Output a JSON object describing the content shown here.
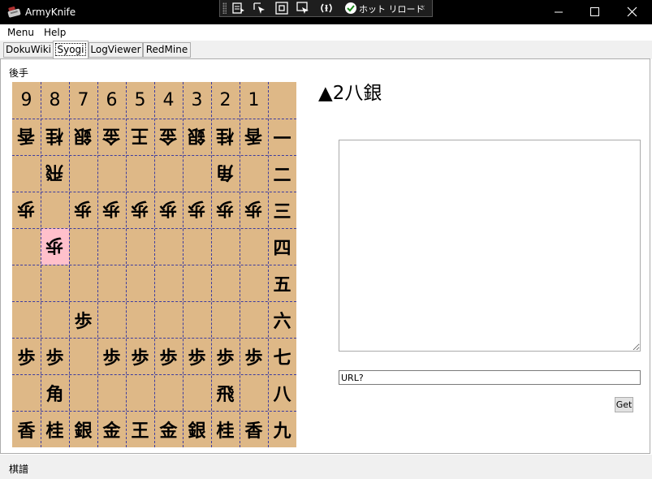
{
  "titlebar": {
    "title": "ArmyKnife",
    "hot_reload_label": "ホット リロード",
    "collapse_glyph": "‹",
    "minimize_glyph": "—",
    "maximize_glyph": "☐",
    "close_glyph": "✕"
  },
  "menu": {
    "items": [
      "Menu",
      "Help"
    ]
  },
  "tabs": [
    {
      "label": "DokuWiki",
      "active": false
    },
    {
      "label": "Syogi",
      "active": true
    },
    {
      "label": "LogViewer",
      "active": false
    },
    {
      "label": "RedMine",
      "active": false
    }
  ],
  "syogi": {
    "gote_label": "後手",
    "file_labels": [
      "9",
      "8",
      "7",
      "6",
      "5",
      "4",
      "3",
      "2",
      "1"
    ],
    "rank_labels": [
      "一",
      "二",
      "三",
      "四",
      "五",
      "六",
      "七",
      "八",
      "九"
    ],
    "rows": [
      [
        [
          "香",
          "g"
        ],
        [
          "桂",
          "g"
        ],
        [
          "銀",
          "g"
        ],
        [
          "金",
          "g"
        ],
        [
          "王",
          "g"
        ],
        [
          "金",
          "g"
        ],
        [
          "銀",
          "g"
        ],
        [
          "桂",
          "g"
        ],
        [
          "香",
          "g"
        ]
      ],
      [
        null,
        [
          "飛",
          "g"
        ],
        null,
        null,
        null,
        null,
        null,
        [
          "角",
          "g"
        ],
        null
      ],
      [
        [
          "歩",
          "g"
        ],
        null,
        [
          "歩",
          "g"
        ],
        [
          "歩",
          "g"
        ],
        [
          "歩",
          "g"
        ],
        [
          "歩",
          "g"
        ],
        [
          "歩",
          "g"
        ],
        [
          "歩",
          "g"
        ],
        [
          "歩",
          "g"
        ]
      ],
      [
        null,
        [
          "歩",
          "g"
        ],
        null,
        null,
        null,
        null,
        null,
        null,
        null
      ],
      [
        null,
        null,
        null,
        null,
        null,
        null,
        null,
        null,
        null
      ],
      [
        null,
        null,
        [
          "歩",
          "s"
        ],
        null,
        null,
        null,
        null,
        null,
        null
      ],
      [
        [
          "歩",
          "s"
        ],
        [
          "歩",
          "s"
        ],
        null,
        [
          "歩",
          "s"
        ],
        [
          "歩",
          "s"
        ],
        [
          "歩",
          "s"
        ],
        [
          "歩",
          "s"
        ],
        [
          "歩",
          "s"
        ],
        [
          "歩",
          "s"
        ]
      ],
      [
        null,
        [
          "角",
          "s"
        ],
        null,
        null,
        null,
        null,
        null,
        [
          "飛",
          "s"
        ],
        null
      ],
      [
        [
          "香",
          "s"
        ],
        [
          "桂",
          "s"
        ],
        [
          "銀",
          "s"
        ],
        [
          "金",
          "s"
        ],
        [
          "王",
          "s"
        ],
        [
          "金",
          "s"
        ],
        [
          "銀",
          "s"
        ],
        [
          "桂",
          "s"
        ],
        [
          "香",
          "s"
        ]
      ]
    ],
    "highlight": {
      "file": "8",
      "rank": "四"
    },
    "last_move": "▲2八銀",
    "kifu_text": "",
    "url_value": "URL?",
    "get_label": "Get"
  },
  "status": {
    "text": "棋譜"
  },
  "colors": {
    "board": "#deb887",
    "grid": "#3c3ca0",
    "highlight": "#ffc0cb"
  }
}
